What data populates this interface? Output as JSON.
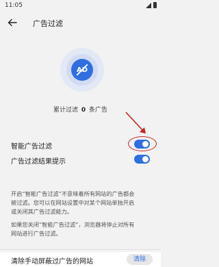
{
  "status_bar": {
    "time": "11:05"
  },
  "header": {
    "title": "广告过滤"
  },
  "badge": {
    "text": "AD"
  },
  "counter": {
    "prefix": "累计过滤",
    "count": "0",
    "suffix": "条广告"
  },
  "settings": {
    "items": [
      {
        "label": "智能广告过滤",
        "enabled": true
      },
      {
        "label": "广告过滤结果提示",
        "enabled": true
      }
    ]
  },
  "description": {
    "p1_lines": [
      "开启“智能广告过滤”不意味着所有网站的广告都会",
      "被过滤。您可以在网站设置中对某个网站单独开启",
      "或关闭其广告过滤能力。"
    ],
    "p2_lines": [
      "如果您关闭“智能广告过滤”，浏览器将停止对所有",
      "网站进行广告过滤。"
    ]
  },
  "clear_section": {
    "label": "清除手动屏蔽过广告的网站",
    "button_label": "清除"
  },
  "colors": {
    "accent": "#2f6fe0",
    "annotation": "#c8211f",
    "background": "#f2f2f2"
  }
}
